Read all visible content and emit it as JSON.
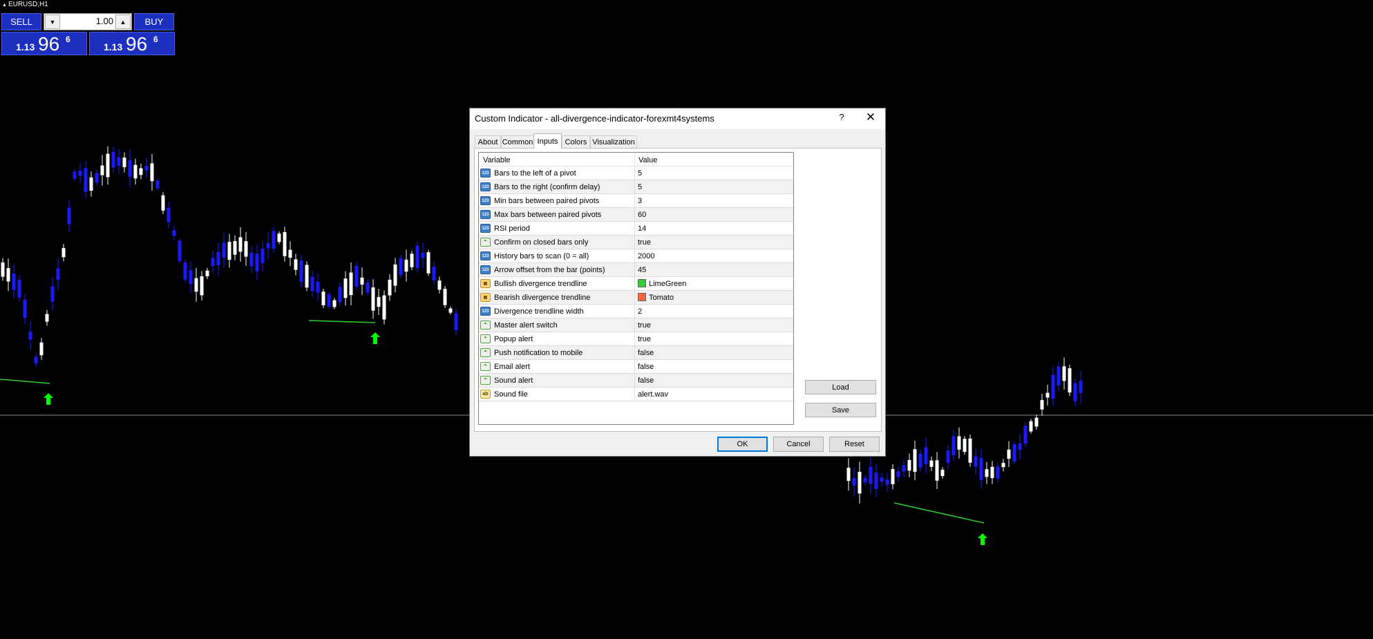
{
  "chart": {
    "symbol": "EURUSD,H1",
    "colors": {
      "bull": "#ffffff",
      "bear": "#1a1aff",
      "trendline": "#32cd32",
      "arrow": "#00ff00",
      "hline": "#8a8a8a"
    }
  },
  "trade_panel": {
    "sell_label": "SELL",
    "buy_label": "BUY",
    "lot_value": "1.00",
    "sell_price_small": "1.13",
    "sell_price_big": "96",
    "sell_price_sup": "6",
    "buy_price_small": "1.13",
    "buy_price_big": "96",
    "buy_price_sup": "6"
  },
  "dialog": {
    "title": "Custom Indicator - all-divergence-indicator-forexmt4systems",
    "help_label": "?",
    "close_label": "✕",
    "tabs": [
      {
        "label": "About"
      },
      {
        "label": "Common"
      },
      {
        "label": "Inputs"
      },
      {
        "label": "Colors"
      },
      {
        "label": "Visualization"
      }
    ],
    "grid": {
      "header_variable": "Variable",
      "header_value": "Value",
      "rows": [
        {
          "icon": "123",
          "variable": "Bars to the left of a pivot",
          "value": "5"
        },
        {
          "icon": "123",
          "variable": "Bars to the right (confirm delay)",
          "value": "5"
        },
        {
          "icon": "123",
          "variable": "Min bars between paired pivots",
          "value": "3"
        },
        {
          "icon": "123",
          "variable": "Max bars between paired pivots",
          "value": "60"
        },
        {
          "icon": "123",
          "variable": "RSI period",
          "value": "14"
        },
        {
          "icon": "bool",
          "variable": "Confirm on closed bars only",
          "value": "true"
        },
        {
          "icon": "123",
          "variable": "History bars to scan (0 = all)",
          "value": "2000"
        },
        {
          "icon": "123",
          "variable": "Arrow offset from the bar (points)",
          "value": "45"
        },
        {
          "icon": "color",
          "variable": "Bullish divergence trendline",
          "value": "LimeGreen",
          "swatch": "#32cd32"
        },
        {
          "icon": "color",
          "variable": "Bearish divergence trendline",
          "value": "Tomato",
          "swatch": "#ff6347"
        },
        {
          "icon": "123",
          "variable": "Divergence trendline width",
          "value": "2"
        },
        {
          "icon": "bool",
          "variable": "Master alert switch",
          "value": "true"
        },
        {
          "icon": "bool",
          "variable": "Popup alert",
          "value": "true"
        },
        {
          "icon": "bool",
          "variable": "Push notification to mobile",
          "value": "false"
        },
        {
          "icon": "bool",
          "variable": "Email alert",
          "value": "false"
        },
        {
          "icon": "bool",
          "variable": "Sound alert",
          "value": "false"
        },
        {
          "icon": "ab",
          "variable": "Sound file",
          "value": "alert.wav"
        }
      ]
    },
    "load_label": "Load",
    "save_label": "Save",
    "ok_label": "OK",
    "cancel_label": "Cancel",
    "reset_label": "Reset"
  }
}
